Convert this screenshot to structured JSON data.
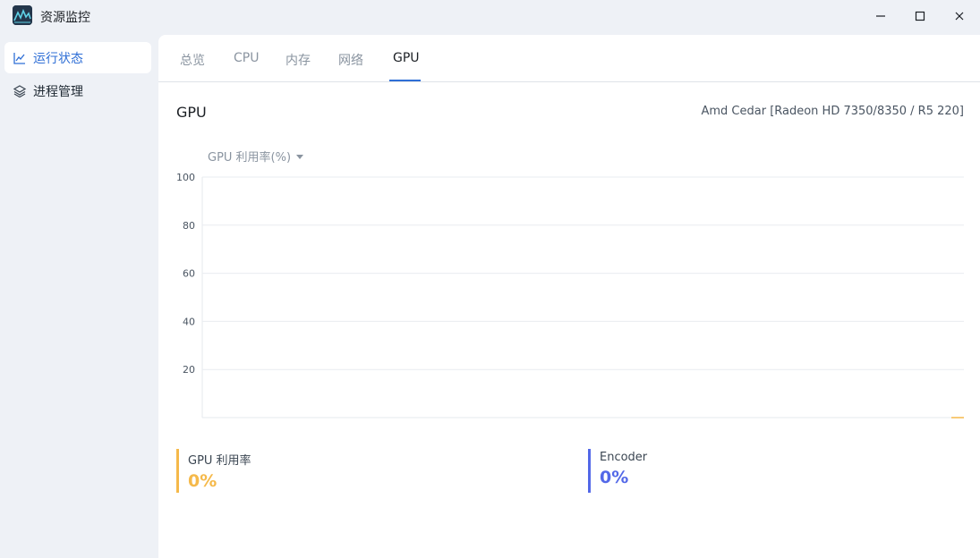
{
  "window": {
    "title": "资源监控",
    "controls": [
      "minimize-icon",
      "maximize-icon",
      "close-icon"
    ]
  },
  "sidebar": {
    "items": [
      {
        "label": "运行状态",
        "icon": "line-chart-icon",
        "active": true
      },
      {
        "label": "进程管理",
        "icon": "layers-icon",
        "active": false
      }
    ]
  },
  "tabs": [
    {
      "label": "总览",
      "active": false
    },
    {
      "label": "CPU",
      "active": false
    },
    {
      "label": "内存",
      "active": false
    },
    {
      "label": "网络",
      "active": false
    },
    {
      "label": "GPU",
      "active": true
    }
  ],
  "section": {
    "title": "GPU",
    "device": "Amd Cedar [Radeon HD 7350/8350 / R5 220]"
  },
  "metric_selector": {
    "value": "GPU 利用率(%)"
  },
  "chart_data": {
    "type": "line",
    "title": "",
    "xlabel": "",
    "ylabel": "",
    "ylim": [
      0,
      100
    ],
    "yticks": [
      20,
      40,
      60,
      80,
      100
    ],
    "grid": true,
    "series": [
      {
        "name": "GPU 利用率",
        "color": "#f5b94a",
        "values": [
          0,
          0
        ]
      },
      {
        "name": "Encoder",
        "color": "#5368e8",
        "values": [
          0,
          0
        ]
      }
    ]
  },
  "stats": [
    {
      "label": "GPU 利用率",
      "value": "0%",
      "color": "#f5b94a"
    },
    {
      "label": "Encoder",
      "value": "0%",
      "color": "#5368e8"
    }
  ],
  "colors": {
    "accent": "#2f6fd6",
    "gpu_series": "#f5b94a",
    "encoder_series": "#5368e8"
  }
}
